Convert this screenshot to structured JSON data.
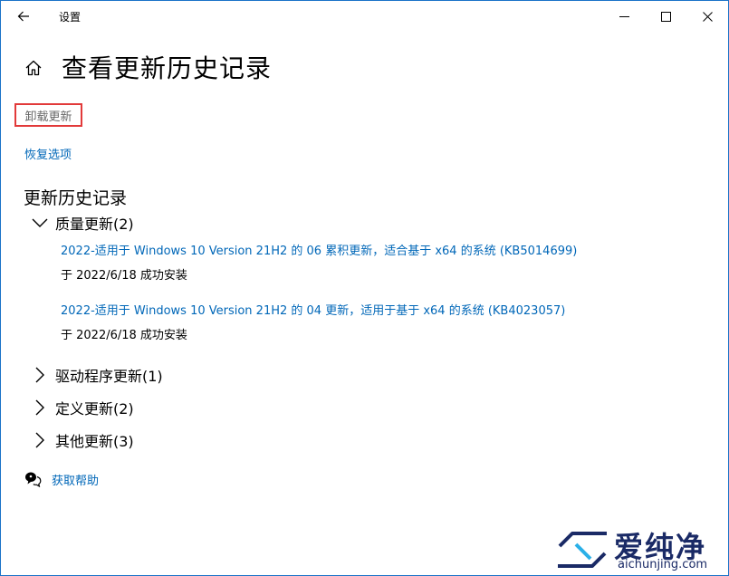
{
  "app": {
    "title": "设置"
  },
  "page": {
    "title": "查看更新历史记录",
    "uninstall_label": "卸载更新",
    "recovery_label": "恢复选项",
    "history_title": "更新历史记录"
  },
  "groups": [
    {
      "label": "质量更新(2)",
      "expanded": true,
      "updates": [
        {
          "title": "2022-适用于 Windows 10 Version 21H2 的 06 累积更新，适合基于 x64 的系统 (KB5014699)",
          "status": "于 2022/6/18 成功安装"
        },
        {
          "title": "2022-适用于 Windows 10 Version 21H2 的 04 更新，适用于基于 x64 的系统 (KB4023057)",
          "status": "于 2022/6/18 成功安装"
        }
      ]
    },
    {
      "label": "驱动程序更新(1)",
      "expanded": false
    },
    {
      "label": "定义更新(2)",
      "expanded": false
    },
    {
      "label": "其他更新(3)",
      "expanded": false
    }
  ],
  "help": {
    "label": "获取帮助"
  },
  "watermark": {
    "cn": "爱纯净",
    "url": "aichunjing.com"
  },
  "icons": {
    "back": "back-arrow-icon",
    "home": "home-icon",
    "minimize": "minimize-icon",
    "maximize": "maximize-icon",
    "close": "close-icon",
    "expanded": "chevron-down-icon",
    "collapsed": "chevron-right-icon",
    "help": "help-chat-icon"
  },
  "colors": {
    "link": "#0067b8",
    "highlight_border": "#e23a3a",
    "window_border": "#1a73c8"
  }
}
